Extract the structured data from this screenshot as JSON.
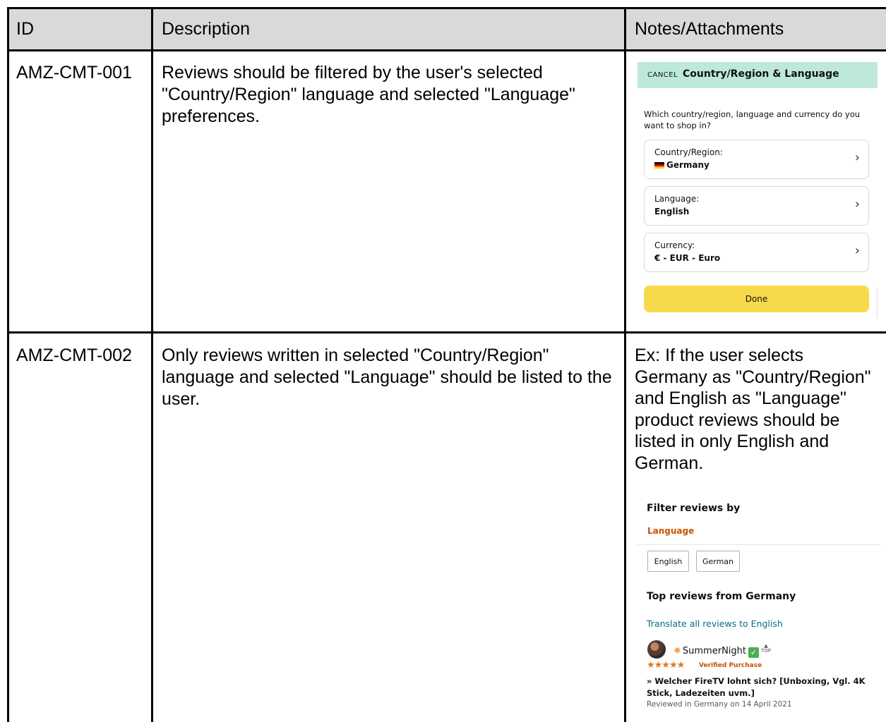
{
  "table": {
    "headers": [
      "ID",
      "Description",
      "Notes/Attachments"
    ],
    "rows": [
      {
        "id": "AMZ-CMT-001",
        "description": "Reviews should be filtered by the user's selected \"Country/Region\" language and selected \"Language\" preferences.",
        "notes": ""
      },
      {
        "id": "AMZ-CMT-002",
        "description": "Only reviews written in selected \"Country/Region\" language and selected \"Language\" should be listed to the user.",
        "notes": "Ex: If the user selects Germany as \"Country/Region\" and English as \"Language\" product reviews should be listed in only English and German."
      }
    ]
  },
  "settings_screenshot": {
    "cancel": "CANCEL",
    "title": "Country/Region & Language",
    "question": "Which country/region, language and currency do you want to shop in?",
    "cards": [
      {
        "label": "Country/Region:",
        "value": "Germany"
      },
      {
        "label": "Language:",
        "value": "English"
      },
      {
        "label": "Currency:",
        "value": "€ - EUR - Euro"
      }
    ],
    "done": "Done",
    "colors": {
      "header": "#bde8da",
      "done_button": "#f7d94c"
    }
  },
  "reviews_screenshot": {
    "filter_title": "Filter reviews by",
    "filter_label": "Language",
    "buttons": [
      "English",
      "German"
    ],
    "top_reviews_title": "Top reviews from Germany",
    "translate_link": "Translate all reviews to English",
    "review": {
      "author": "SummerNight",
      "badge": "TOP",
      "rating": 5,
      "stars": "★★★★★",
      "verified": "Verified Purchase",
      "title": "» Welcher FireTV lohnt sich? [Unboxing, Vgl. 4K Stick, Ladezeiten uvm.]",
      "date": "Reviewed in Germany on 14 April 2021"
    },
    "colors": {
      "link": "#007185",
      "accent": "#c45500",
      "stars": "#de7921"
    }
  }
}
